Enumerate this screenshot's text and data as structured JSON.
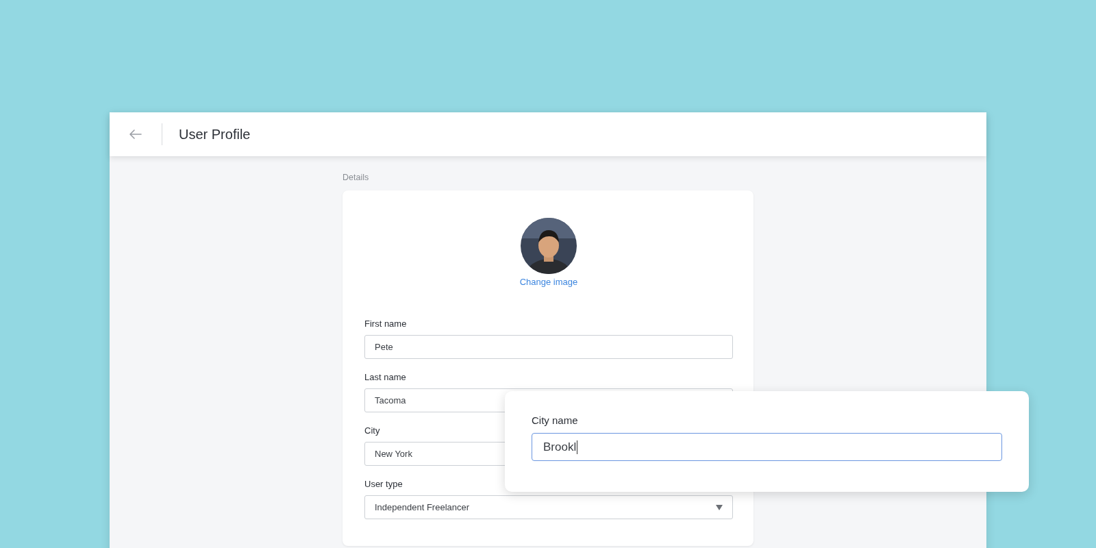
{
  "window": {
    "title": "User Profile"
  },
  "section_label": "Details",
  "profile": {
    "kind": "picture",
    "action": "Change image"
  },
  "fields": [
    {
      "kind": "text",
      "label": "First name",
      "value": "Pete"
    },
    {
      "kind": "text",
      "label": "Last name",
      "value": "Tacoma"
    },
    {
      "kind": "text",
      "label": "City",
      "value": "New York"
    },
    {
      "kind": "select",
      "label": "User type",
      "value": "Independent Freelancer"
    }
  ],
  "popup": {
    "label": "City name",
    "value": "Brookl",
    "focused": true
  }
}
